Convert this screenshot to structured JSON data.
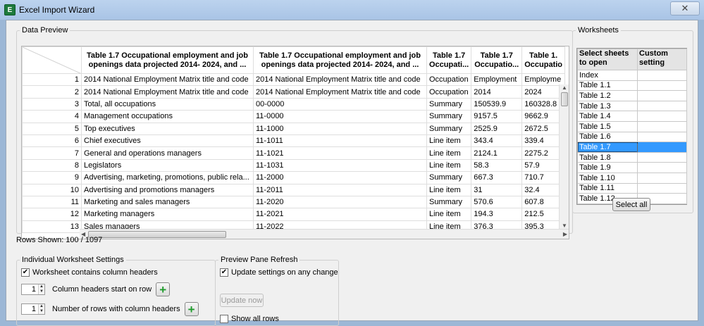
{
  "window": {
    "title": "Excel Import Wizard",
    "close_glyph": "✕",
    "icon": "excel-icon"
  },
  "data_preview": {
    "legend": "Data Preview",
    "columns": [
      "Table 1.7 Occupational employment and job openings data projected 2014- 2024, and ...",
      "Table 1.7 Occupational employment and job openings data projected 2014- 2024, and ...",
      "Table 1.7 Occupati...",
      "Table 1.7 Occupatio...",
      "Table 1. Occupatio"
    ],
    "rows": [
      [
        "1",
        "2014 National Employment Matrix title and code",
        "2014 National Employment Matrix title and code",
        "Occupation",
        "Employment",
        "Employme"
      ],
      [
        "2",
        "2014 National Employment Matrix title and code",
        "2014 National Employment Matrix title and code",
        "Occupation",
        "2014",
        "2024"
      ],
      [
        "3",
        "Total, all occupations",
        "00-0000",
        "Summary",
        "150539.9",
        "160328.8"
      ],
      [
        "4",
        "Management occupations",
        "11-0000",
        "Summary",
        "9157.5",
        "9662.9"
      ],
      [
        "5",
        "Top executives",
        "11-1000",
        "Summary",
        "2525.9",
        "2672.5"
      ],
      [
        "6",
        "Chief executives",
        "11-1011",
        "Line item",
        "343.4",
        "339.4"
      ],
      [
        "7",
        "General and operations managers",
        "11-1021",
        "Line item",
        "2124.1",
        "2275.2"
      ],
      [
        "8",
        "Legislators",
        "11-1031",
        "Line item",
        "58.3",
        "57.9"
      ],
      [
        "9",
        "Advertising, marketing, promotions, public rela...",
        "11-2000",
        "Summary",
        "667.3",
        "710.7"
      ],
      [
        "10",
        "Advertising and promotions managers",
        "11-2011",
        "Line item",
        "31",
        "32.4"
      ],
      [
        "11",
        "Marketing and sales managers",
        "11-2020",
        "Summary",
        "570.6",
        "607.8"
      ],
      [
        "12",
        "Marketing managers",
        "11-2021",
        "Line item",
        "194.3",
        "212.5"
      ],
      [
        "13",
        "Sales managers",
        "11-2022",
        "Line item",
        "376.3",
        "395.3"
      ]
    ]
  },
  "rows_shown": "Rows Shown: 100 / 1097",
  "worksheets": {
    "legend": "Worksheets",
    "header_select": "Select sheets to open",
    "header_custom": "Custom setting",
    "sheets": [
      "Index",
      "Table 1.1",
      "Table 1.2",
      "Table 1.3",
      "Table 1.4",
      "Table 1.5",
      "Table 1.6",
      "Table 1.7",
      "Table 1.8",
      "Table 1.9",
      "Table 1.10",
      "Table 1.11",
      "Table 1.12"
    ],
    "selected": "Table 1.7",
    "select_all_label": "Select all"
  },
  "individual_settings": {
    "legend": "Individual Worksheet Settings",
    "contains_headers_label": "Worksheet contains column headers",
    "contains_headers_checked": true,
    "headers_start_value": "1",
    "headers_start_label": "Column headers start on row",
    "header_rows_value": "1",
    "header_rows_label": "Number of rows with column headers"
  },
  "preview_refresh": {
    "legend": "Preview Pane Refresh",
    "update_on_change_label": "Update settings on any change",
    "update_on_change_checked": true,
    "update_now_label": "Update now",
    "show_all_rows_label": "Show all rows",
    "show_all_rows_checked": false
  }
}
